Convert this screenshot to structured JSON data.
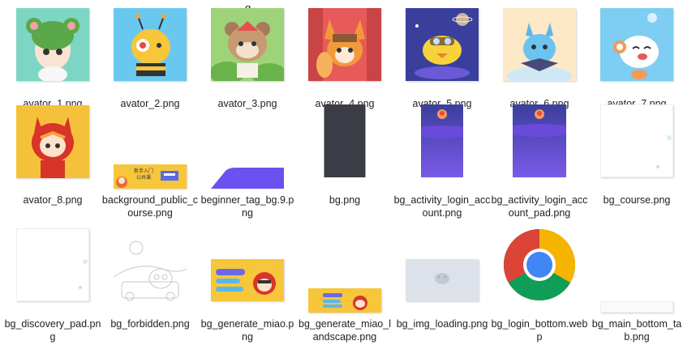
{
  "top_fragment": "g",
  "files": [
    {
      "label": "avator_1.png",
      "icon": "avatar-thumbnail-icon"
    },
    {
      "label": "avator_2.png",
      "icon": "avatar-thumbnail-icon"
    },
    {
      "label": "avator_3.png",
      "icon": "avatar-thumbnail-icon"
    },
    {
      "label": "avator_4.png",
      "icon": "avatar-thumbnail-icon"
    },
    {
      "label": "avator_5.png",
      "icon": "avatar-thumbnail-icon"
    },
    {
      "label": "avator_6.png",
      "icon": "avatar-thumbnail-icon"
    },
    {
      "label": "avator_7.png",
      "icon": "avatar-thumbnail-icon"
    },
    {
      "label": "avator_8.png",
      "icon": "avatar-thumbnail-icon"
    },
    {
      "label": "background_public_course.png",
      "icon": "image-thumbnail-icon",
      "thumb_text": "新手入门 公共课"
    },
    {
      "label": "beginner_tag_bg.9.png",
      "icon": "image-thumbnail-icon"
    },
    {
      "label": "bg.png",
      "icon": "image-thumbnail-icon"
    },
    {
      "label": "bg_activity_login_account.png",
      "icon": "image-thumbnail-icon"
    },
    {
      "label": "bg_activity_login_account_pad.png",
      "icon": "image-thumbnail-icon"
    },
    {
      "label": "bg_course.png",
      "icon": "image-thumbnail-icon"
    },
    {
      "label": "bg_discovery_pad.png",
      "icon": "image-thumbnail-icon"
    },
    {
      "label": "bg_forbidden.png",
      "icon": "image-thumbnail-icon"
    },
    {
      "label": "bg_generate_miao.png",
      "icon": "image-thumbnail-icon"
    },
    {
      "label": "bg_generate_miao_landscape.png",
      "icon": "image-thumbnail-icon"
    },
    {
      "label": "bg_img_loading.png",
      "icon": "image-thumbnail-icon"
    },
    {
      "label": "bg_login_bottom.webp",
      "icon": "chrome-icon"
    },
    {
      "label": "bg_main_bottom_tab.png",
      "icon": "image-thumbnail-icon"
    }
  ],
  "colors": {
    "dark_slate": "#3a3c46",
    "purple": "#6a52f0",
    "yellow": "#f5c234"
  }
}
